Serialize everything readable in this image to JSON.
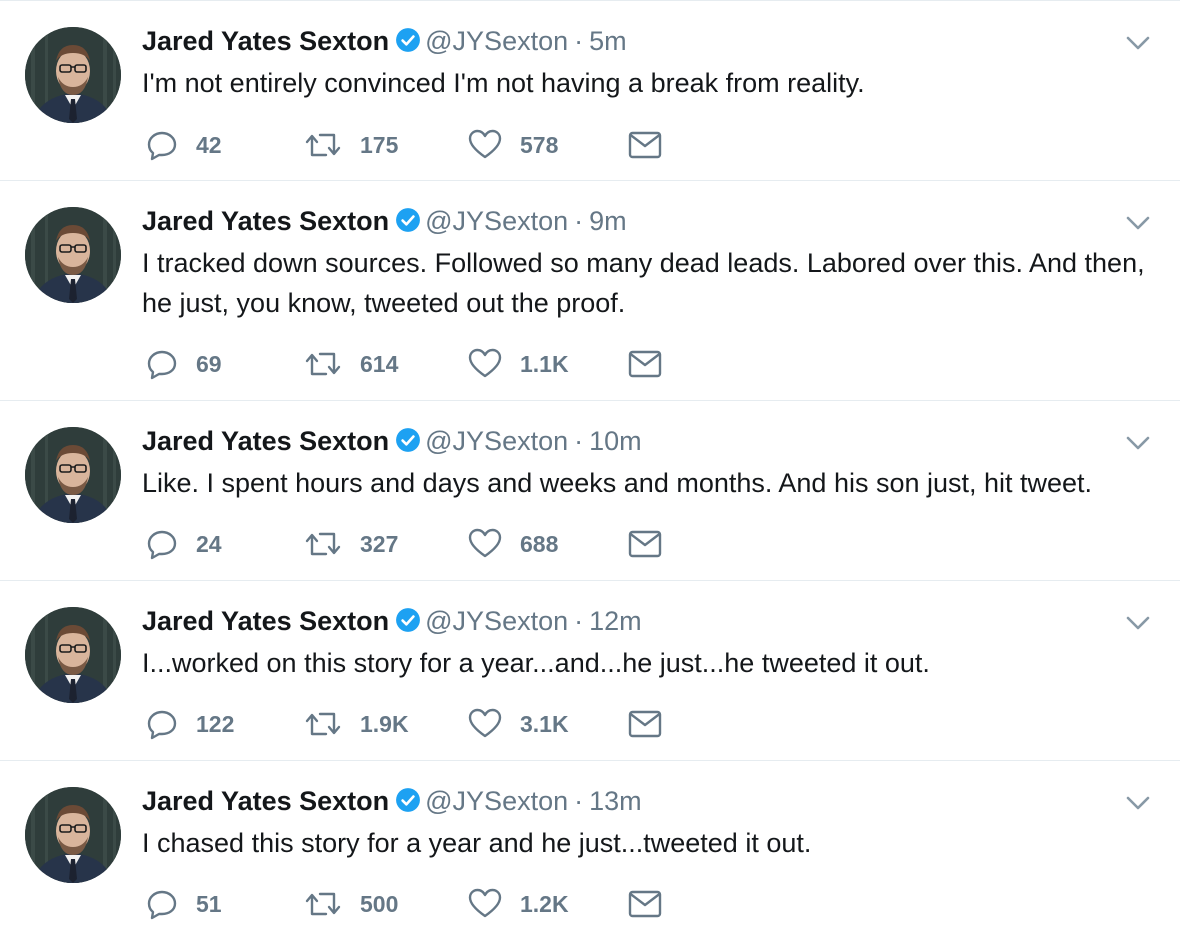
{
  "tweets": [
    {
      "name": "Jared Yates Sexton",
      "handle": "@JYSexton",
      "separator": "·",
      "time": "5m",
      "text": "I'm not entirely convinced I'm not having a break from reality.",
      "replies": "42",
      "retweets": "175",
      "likes": "578"
    },
    {
      "name": "Jared Yates Sexton",
      "handle": "@JYSexton",
      "separator": "·",
      "time": "9m",
      "text": "I tracked down sources. Followed so many dead leads. Labored over this. And then, he just, you know, tweeted out the proof.",
      "replies": "69",
      "retweets": "614",
      "likes": "1.1K"
    },
    {
      "name": "Jared Yates Sexton",
      "handle": "@JYSexton",
      "separator": "·",
      "time": "10m",
      "text": "Like. I spent hours and days and weeks and months. And his son just, hit tweet.",
      "replies": "24",
      "retweets": "327",
      "likes": "688"
    },
    {
      "name": "Jared Yates Sexton",
      "handle": "@JYSexton",
      "separator": "·",
      "time": "12m",
      "text": "I...worked on this story for a year...and...he just...he tweeted it out.",
      "replies": "122",
      "retweets": "1.9K",
      "likes": "3.1K"
    },
    {
      "name": "Jared Yates Sexton",
      "handle": "@JYSexton",
      "separator": "·",
      "time": "13m",
      "text": "I chased this story for a year and he just...tweeted it out.",
      "replies": "51",
      "retweets": "500",
      "likes": "1.2K"
    }
  ],
  "icons": {
    "reply": "reply-icon",
    "retweet": "retweet-icon",
    "like": "heart-icon",
    "dm": "envelope-icon",
    "verified": "verified-badge-icon",
    "menu": "chevron-down-icon"
  },
  "colors": {
    "verified": "#1da1f2",
    "icon": "#657786",
    "divider": "#e6ecf0"
  }
}
